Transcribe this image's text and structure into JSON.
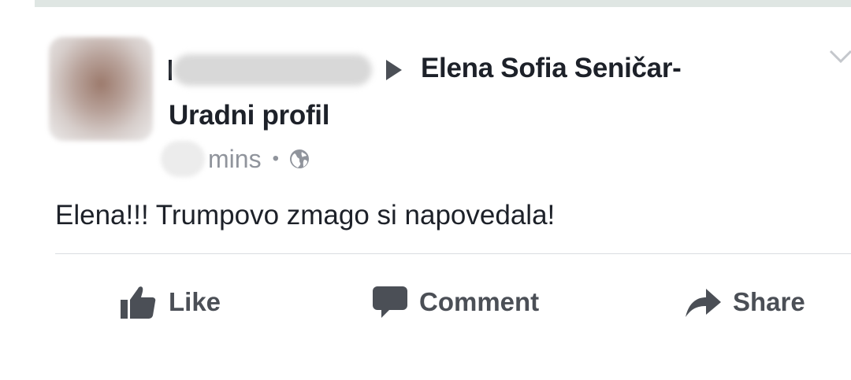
{
  "post": {
    "target_name": "Elena Sofia Seničar-",
    "target_name_line2": "Uradni profil",
    "time_suffix": "mins",
    "separator": "•",
    "text": "Elena!!! Trumpovo zmago si napovedala!"
  },
  "actions": {
    "like": "Like",
    "comment": "Comment",
    "share": "Share"
  },
  "icons": {
    "privacy": "globe-icon",
    "menu": "chevron-down-icon",
    "like": "thumbs-up-icon",
    "comment": "speech-bubble-icon",
    "share": "share-arrow-icon"
  },
  "colors": {
    "text": "#1d2129",
    "muted": "#90949c",
    "action": "#4b4f56",
    "divider": "#dadde1"
  }
}
